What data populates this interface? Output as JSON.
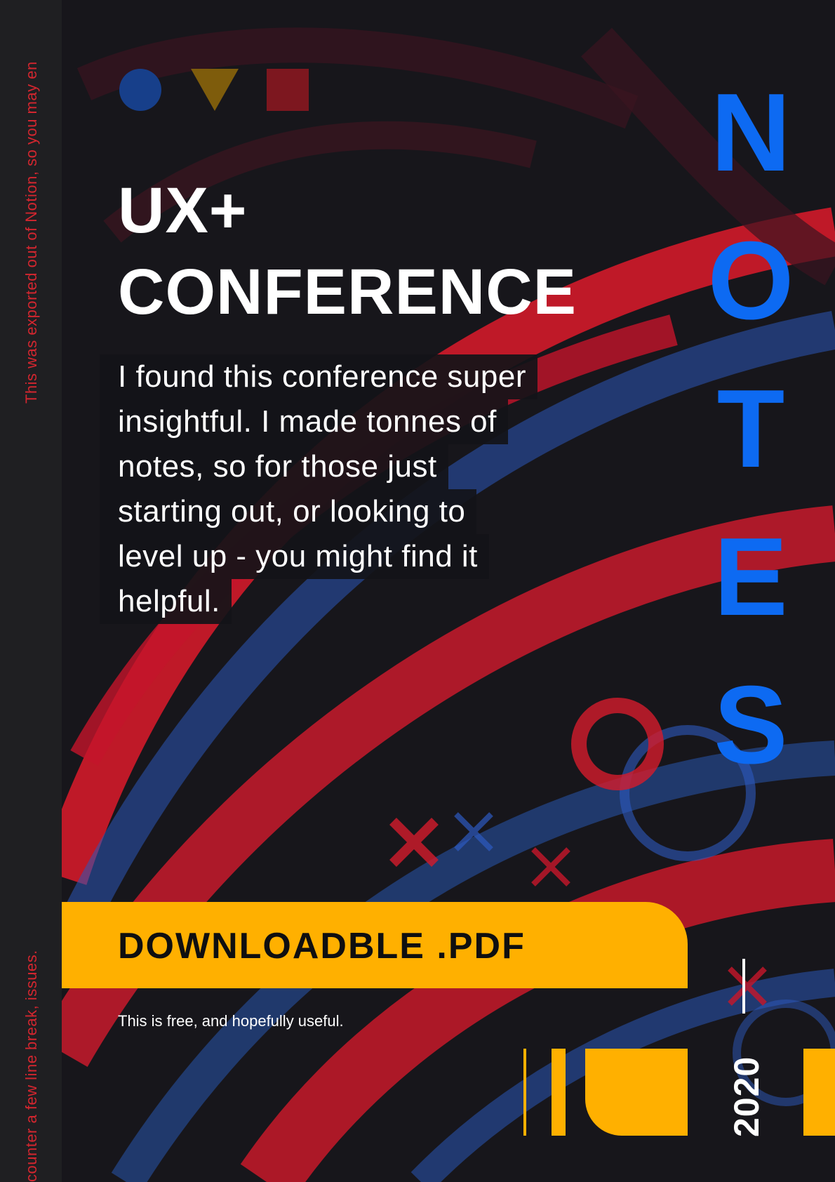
{
  "side_note": {
    "top": "This was exported out of Notion, so you may en",
    "bottom": "counter a few line break, issues."
  },
  "title": {
    "line1": "UX+",
    "line2": "CONFERENCE"
  },
  "intro_lines": [
    "I found this conference super",
    "insightful. I made tonnes of",
    "notes, so for those just",
    "starting out, or looking to",
    "level up - you might find it",
    "helpful."
  ],
  "notes_letters": [
    "N",
    "O",
    "T",
    "E",
    "S"
  ],
  "download": {
    "label": "DOWNLOADBLE .PDF"
  },
  "subnote": "This is free, and hopefully useful.",
  "year": "2020",
  "colors": {
    "accent_blue": "#0d6af2",
    "accent_yellow": "#ffb000",
    "accent_red": "#d3262f",
    "background": "#17161b"
  },
  "icons": [
    "circle-shape-icon",
    "triangle-shape-icon",
    "square-shape-icon"
  ]
}
